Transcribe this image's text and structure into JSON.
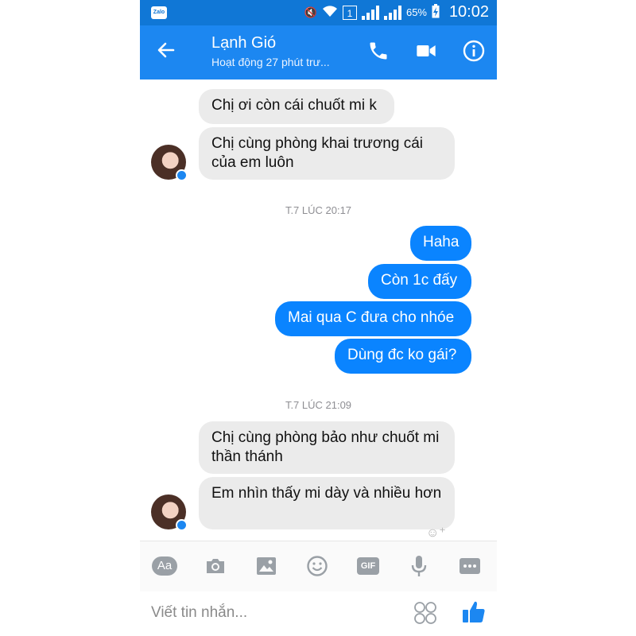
{
  "statusbar": {
    "app_badge": "Zalo",
    "sim_slot": "1",
    "battery": "65%",
    "time": "10:02"
  },
  "header": {
    "contact_name": "Lạnh Gió",
    "activity_status": "Hoạt động 27 phút trư...",
    "icons": [
      "back-arrow-icon",
      "phone-icon",
      "video-camera-icon",
      "info-icon"
    ]
  },
  "messages": [
    {
      "side": "in",
      "text": "Chị ơi còn cái chuốt mi k"
    },
    {
      "side": "in",
      "text": "Chị cùng phòng khai trương cái của em luôn"
    },
    {
      "type": "timestamp",
      "text": "T.7 LÚC 20:17"
    },
    {
      "side": "out",
      "text": "Haha"
    },
    {
      "side": "out",
      "text": "Còn 1c đấy"
    },
    {
      "side": "out",
      "text": "Mai qua C đưa cho nhóe"
    },
    {
      "side": "out",
      "text": "Dùng đc ko gái?"
    },
    {
      "type": "timestamp",
      "text": "T.7 LÚC 21:09"
    },
    {
      "side": "in",
      "text": "Chị cùng phòng bảo như chuốt mi thần thánh"
    },
    {
      "side": "in",
      "text": "Em nhìn thấy mi dày và nhiều hơn"
    }
  ],
  "toolbar": {
    "text_style_label": "Aa",
    "gif_label": "GIF",
    "icons": [
      "text-style-icon",
      "camera-icon",
      "image-icon",
      "emoji-icon",
      "gif-icon",
      "microphone-icon",
      "more-icon"
    ]
  },
  "composer": {
    "placeholder": "Viết tin nhắn...",
    "icons": [
      "sticker-grid-icon",
      "thumbs-up-icon"
    ]
  },
  "colors": {
    "header_blue": "#1c87f1",
    "status_blue": "#1077d6",
    "outgoing_bubble": "#0a84ff",
    "incoming_bubble": "#ebebeb"
  }
}
